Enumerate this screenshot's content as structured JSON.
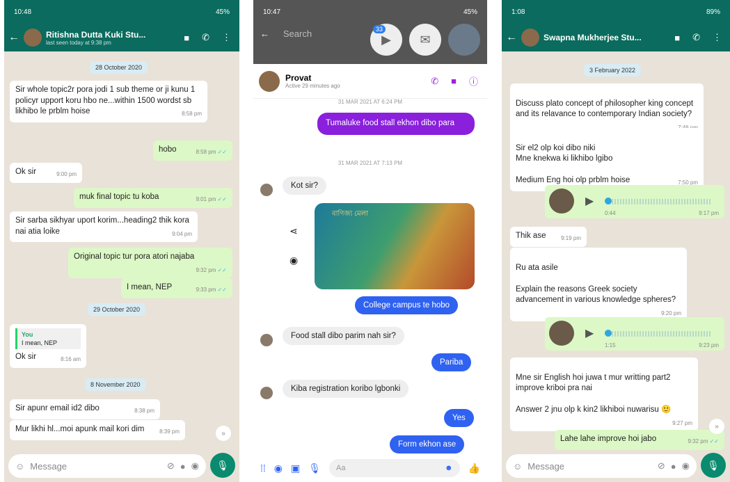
{
  "p1": {
    "status_time": "10:48",
    "status_right": "45%",
    "contact_name": "Ritishna Dutta Kuki Stu...",
    "last_seen": "last seen today at 9:38 pm",
    "messages": {
      "d1": "28 October 2020",
      "m1": "Sir whole topic2r pora jodi 1 sub theme or ji kunu 1 policyr upport koru hbo ne...within 1500 wordst sb likhibo le prblm hoise",
      "t1": "8:58 pm",
      "m2": "hobo",
      "t2": "8:58 pm",
      "m3": "Ok sir",
      "t3": "9:00 pm",
      "m4": "muk final topic tu koba",
      "t4": "9:01 pm",
      "m5": "Sir sarba sikhyar uport korim...heading2 thik kora nai atia loike",
      "t5": "9:04 pm",
      "m6": "Original topic tur pora atori najaba",
      "t6": "9:32 pm",
      "m7": "I mean, NEP",
      "t7": "9:33 pm",
      "d2": "29 October 2020",
      "q_name": "You",
      "q_text": "I mean, NEP",
      "m8": "Ok sir",
      "t8": "8:16 am",
      "d3": "8 November 2020",
      "m9": "Sir apunr email id2 dibo",
      "t9": "8:38 pm",
      "m10": "Mur likhi hl...moi apunk mail kori dim",
      "t10": "8:39 pm"
    },
    "input_placeholder": "Message"
  },
  "p2": {
    "status_time": "10:47",
    "status_right": "45%",
    "search_placeholder": "Search",
    "badge": "33",
    "contact_name": "Provat",
    "active": "Active 29 minutes ago",
    "s1": "31 MAR 2021 AT 6:24 PM",
    "m1": "Tumaluke food stall ekhon dibo para",
    "s2": "31 MAR 2021 AT 7:13 PM",
    "m2": "Kot sir?",
    "card_text": "বাণিজ্য মেলা",
    "m3": "College campus te hobo",
    "m4": "Food stall dibo parim nah sir?",
    "m5": "Pariba",
    "m6": "Kiba registration koribo lgbonki",
    "m7": "Yes",
    "m8": "Form ekhon ase",
    "input_placeholder": "Aa"
  },
  "p3": {
    "status_time": "1:08",
    "status_right": "89%",
    "contact_name": "Swapna Mukherjee Stu...",
    "d1": "3 February 2022",
    "m1": "Discuss plato concept of philosopher king concept and its relavance to contemporary Indian society?",
    "t1": "7:46 pm",
    "m2": "Sir el2 olp koi dibo niki\nMne knekwa ki likhibo lgibo\n\nMedium Eng hoi olp prblm hoise",
    "t2": "7:50 pm",
    "v1_dur": "0:44",
    "v1_time": "9:17 pm",
    "m3": "Thik ase",
    "t3": "9:19 pm",
    "m4": "Ru ata asile\n\nExplain the reasons Greek society advancement in various knowledge spheres?",
    "t4": "9:20 pm",
    "v2_dur": "1:15",
    "v2_time": "9:23 pm",
    "m5": "Mne sir English hoi juwa t mur writting part2 improve kriboi pra nai\n\nAnswer 2 jnu olp k kin2 likhiboi nuwarisu",
    "t5": "9:27 pm",
    "m6": "Lahe lahe improve hoi jabo",
    "t6": "9:32 pm",
    "input_placeholder": "Message"
  },
  "colors": {
    "wa_header": "#0a6b5e",
    "wa_out": "#dcf8c6",
    "ms_purple": "#8a1fdc",
    "ms_blue": "#2f62f0"
  }
}
